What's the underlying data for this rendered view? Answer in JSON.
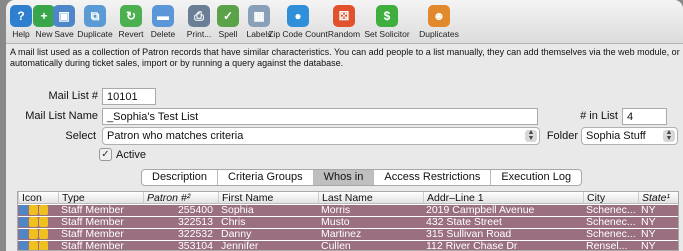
{
  "toolbar": [
    {
      "name": "help",
      "label": "Help",
      "icon": "help-icon",
      "color": "#2f7fd1",
      "glyph": "?"
    },
    {
      "name": "new",
      "label": "New",
      "icon": "new-plus-icon",
      "color": "#3aa64b",
      "glyph": "+"
    },
    {
      "name": "save",
      "label": "Save",
      "icon": "save-disk-icon",
      "color": "#4d86c9",
      "glyph": "▣"
    },
    {
      "name": "duplicate",
      "label": "Duplicate",
      "icon": "duplicate-icon",
      "color": "#5b9bd5",
      "glyph": "⧉"
    },
    {
      "name": "revert",
      "label": "Revert",
      "icon": "revert-arrows-icon",
      "color": "#4caf50",
      "glyph": "↻"
    },
    {
      "name": "delete",
      "label": "Delete",
      "icon": "trash-icon",
      "color": "#5a96d8",
      "glyph": "▬"
    },
    {
      "name": "print",
      "label": "Print...",
      "icon": "printer-icon",
      "color": "#6a7f96",
      "glyph": "⎙"
    },
    {
      "name": "spell",
      "label": "Spell",
      "icon": "spellcheck-icon",
      "color": "#5aa349",
      "glyph": "✓"
    },
    {
      "name": "labels",
      "label": "Labels",
      "icon": "labels-grid-icon",
      "color": "#8aa0b8",
      "glyph": "▦"
    },
    {
      "name": "zip",
      "label": "Zip Code Count",
      "icon": "globe-icon",
      "color": "#2f8fd8",
      "glyph": "●"
    },
    {
      "name": "random",
      "label": "Random",
      "icon": "dice-icon",
      "color": "#e0532d",
      "glyph": "⚄"
    },
    {
      "name": "solicitor",
      "label": "Set Solicitor",
      "icon": "dollar-icon",
      "color": "#3fae3f",
      "glyph": "$"
    },
    {
      "name": "duplicates",
      "label": "Duplicates",
      "icon": "people-duplicates-icon",
      "color": "#e08a2d",
      "glyph": "☻"
    }
  ],
  "description": "A mail list used as a collection of Patron records that have similar characteristics.  You can add people to a list manually, they can add themselves via the web module, or automatically during ticket sales, import or by running a query against the database.",
  "form": {
    "mail_list_label": "Mail List #",
    "mail_list_value": "10101",
    "name_label": "Mail List Name",
    "name_value": "_Sophia's Test List",
    "in_list_label": "# in List",
    "in_list_value": "4",
    "select_label": "Select",
    "select_value": "Patron who matches criteria",
    "folder_label": "Folder",
    "folder_value": "Sophia Stuff",
    "active_label": "Active",
    "active_checked": true
  },
  "tabs": [
    {
      "label": "Description",
      "active": false
    },
    {
      "label": "Criteria Groups",
      "active": false
    },
    {
      "label": "Whos in",
      "active": true
    },
    {
      "label": "Access Restrictions",
      "active": false
    },
    {
      "label": "Execution Log",
      "active": false
    }
  ],
  "grid": {
    "columns": [
      "Icon",
      "Type",
      "Patron #²",
      "First Name",
      "Last Name",
      "Addr–Line 1",
      "City",
      "State¹"
    ],
    "rows": [
      {
        "type": "Staff Member",
        "patron": "255400",
        "first": "Sophia",
        "last": "Morris",
        "addr": "2019 Campbell Avenue",
        "city": "Schenec...",
        "state": "NY"
      },
      {
        "type": "Staff Member",
        "patron": "322513",
        "first": "Chris",
        "last": "Musto",
        "addr": "432 State Street",
        "city": "Schenec...",
        "state": "NY"
      },
      {
        "type": "Staff Member",
        "patron": "322532",
        "first": "Danny",
        "last": "Martinez",
        "addr": "315 Sullivan Road",
        "city": "Schenec...",
        "state": "NY"
      },
      {
        "type": "Staff Member",
        "patron": "353104",
        "first": "Jennifer",
        "last": "Cullen",
        "addr": "112 River Chase Dr",
        "city": "Rensel...",
        "state": "NY"
      }
    ]
  },
  "colors": {
    "row_highlight": "#9a6f80",
    "active_tab": "#bfbfbf"
  }
}
